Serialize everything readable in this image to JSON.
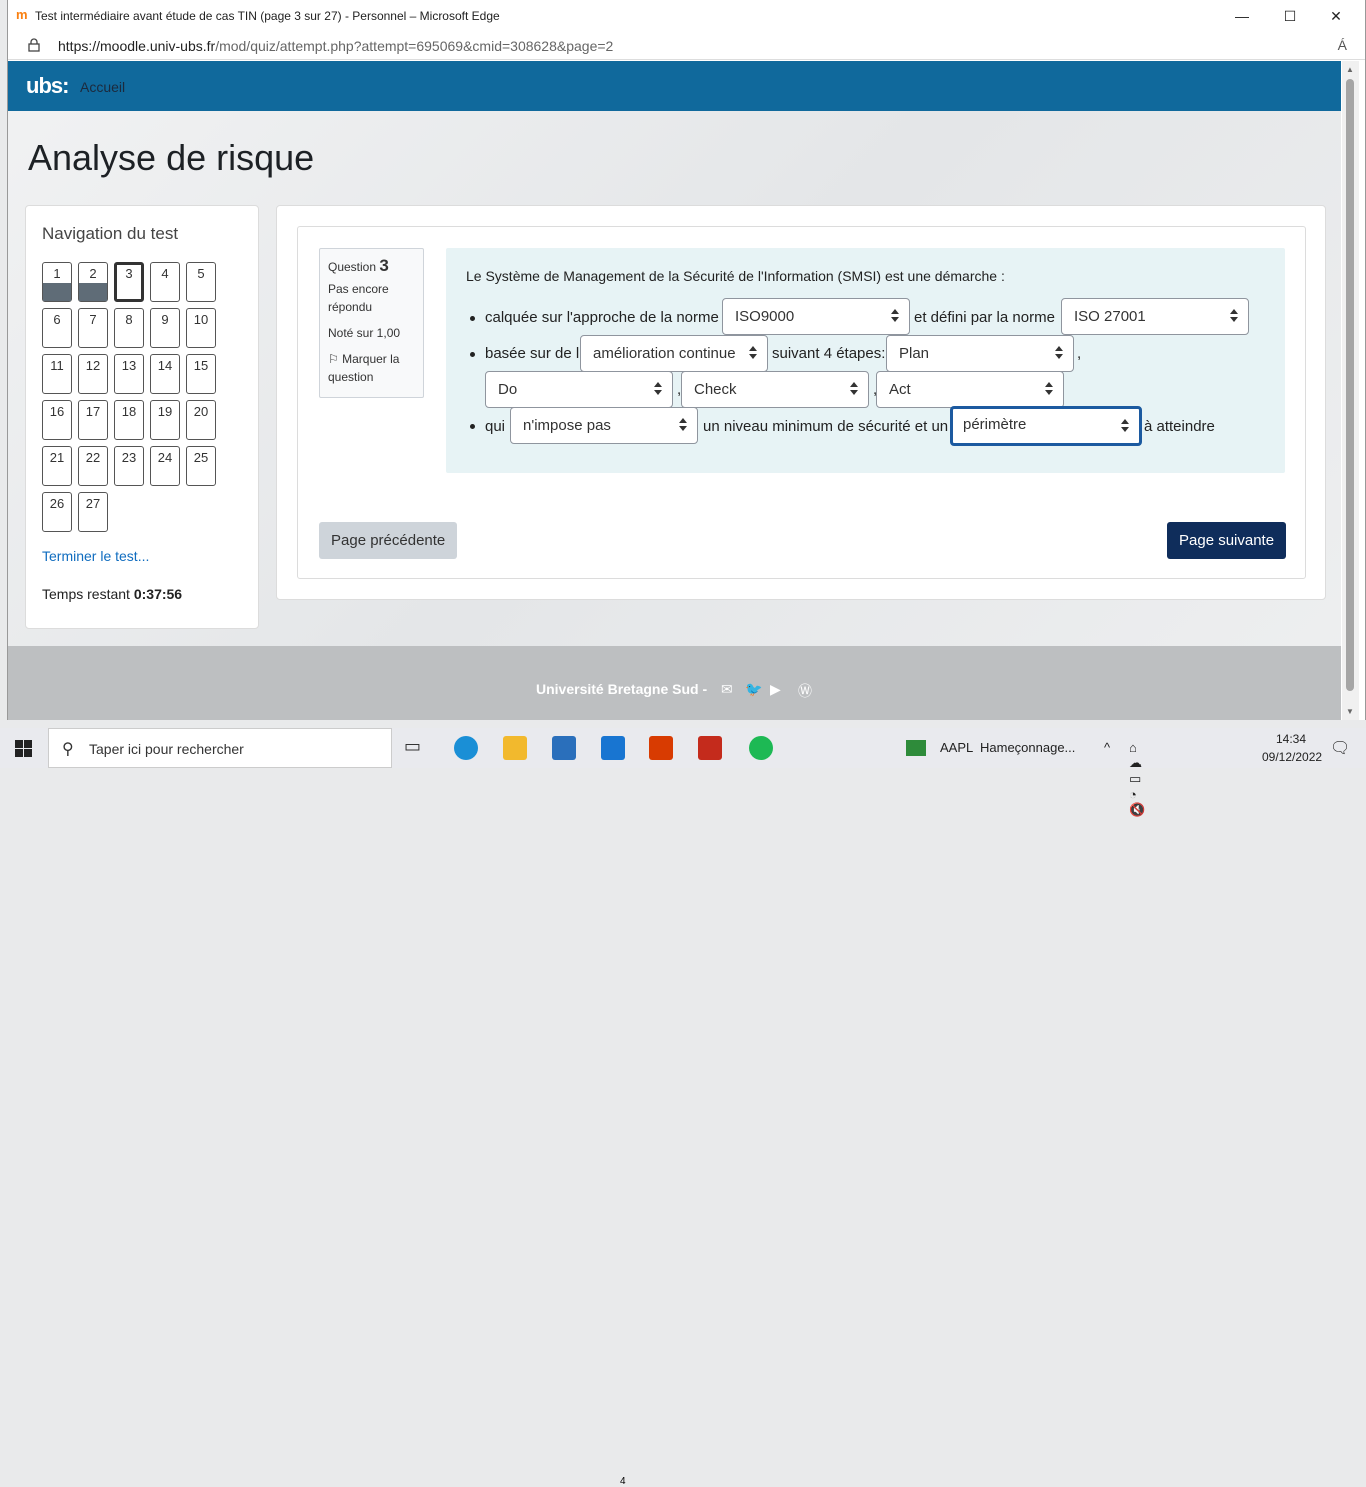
{
  "window": {
    "title": "Test intermédiaire avant étude de cas TIN (page 3 sur 27) - Personnel – Microsoft Edge",
    "minimize": "—",
    "maximize": "☐",
    "close": "✕"
  },
  "address_bar": {
    "url_host": "https://moodle.univ-ubs.fr",
    "url_path": "/mod/quiz/attempt.php?attempt=695069&cmid=308628&page=2",
    "read_aloud": "Á"
  },
  "navbar": {
    "logo": "ubs:",
    "home": "Accueil"
  },
  "page_title": "Analyse de risque",
  "quiz_nav": {
    "title": "Navigation du test",
    "questions": [
      "1",
      "2",
      "3",
      "4",
      "5",
      "6",
      "7",
      "8",
      "9",
      "10",
      "11",
      "12",
      "13",
      "14",
      "15",
      "16",
      "17",
      "18",
      "19",
      "20",
      "21",
      "22",
      "23",
      "24",
      "25",
      "26",
      "27"
    ],
    "finish": "Terminer le test...",
    "time_label": "Temps restant",
    "time_value": "0:37:56"
  },
  "question": {
    "label": "Question",
    "number": "3",
    "status": "Pas encore répondu",
    "grade": "Noté sur 1,00",
    "flag": "Marquer la question",
    "intro": "Le Système de Management de la Sécurité de l'Information (SMSI) est une démarche :",
    "l1_a": "calquée sur l'approche de la norme",
    "l1_sel1": "ISO9000",
    "l1_b": "et défini par la norme",
    "l1_sel2": "ISO 27001",
    "l2_a": "basée sur de l'",
    "l2_sel1": "amélioration continue",
    "l2_b": "suivant 4 étapes:",
    "l2_sel2": "Plan",
    "comma": ",",
    "l3_sel1": "Do",
    "l3_sel2": "Check",
    "l3_sel3": "Act",
    "l4_a": "qui",
    "l4_sel1": "n'impose pas",
    "l4_b": "un niveau minimum de sécurité et un",
    "l4_sel2": "périmètre",
    "l4_c": "à atteindre"
  },
  "buttons": {
    "prev": "Page précédente",
    "next": "Page suivante"
  },
  "footer": {
    "text": "Université Bretagne Sud -",
    "icons": [
      "mail-icon",
      "twitter-icon",
      "youtube-icon",
      "wordpress-icon"
    ]
  },
  "taskbar": {
    "search_placeholder": "Taper ici pour rechercher",
    "mail_badge": "4",
    "stock": "AAPL",
    "news": "Hameçonnage...",
    "time": "14:34",
    "date": "09/12/2022"
  }
}
